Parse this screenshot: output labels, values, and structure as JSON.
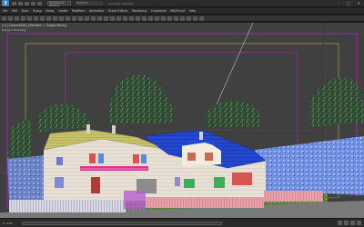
{
  "app": {
    "logo_text": "3",
    "workspace": "Workspace: Default",
    "doc_title": "Default+",
    "window_title": "Autodesk 3ds Max"
  },
  "menu": [
    "File",
    "Edit",
    "Tools",
    "Group",
    "Views",
    "Create",
    "Modifiers",
    "Animation",
    "Graph Editors",
    "Rendering",
    "Customize",
    "MAXScript",
    "Help"
  ],
  "viewport": {
    "label": "[+] [Camera001] [Realistic + Edged Faces]",
    "sub_label": "Polygon Modeling",
    "frame_colors": {
      "safe_frame": "#c21ad9",
      "title_safe": "#b4b34b",
      "live_area": "#b22bb6"
    }
  },
  "status": {
    "left": "0 / 100"
  }
}
